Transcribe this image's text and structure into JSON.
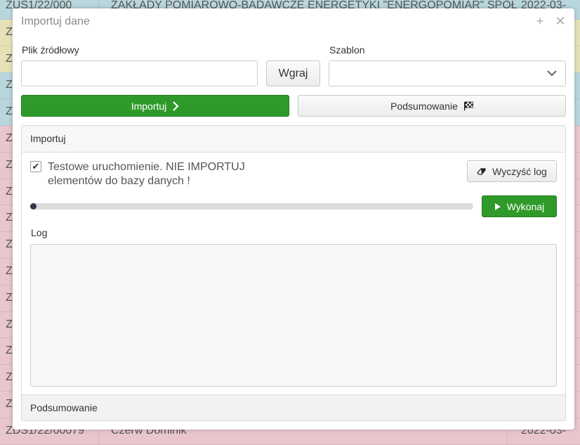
{
  "background": {
    "rows": [
      {
        "c1": "ZUS1/22/000",
        "c2": "ZAKŁADY POMIAROWO-BADAWCZE ENERGETYKI \"ENERGOPOMIAR\" SPÓŁ",
        "c3": "2022-03-",
        "color": "#b9d6dd"
      },
      {
        "c1": "ZU",
        "c2": "",
        "c3": "",
        "color": "#e6e2b8"
      },
      {
        "c1": "ZU",
        "c2": "",
        "c3": "",
        "color": "#e6e2b8"
      },
      {
        "c1": "ZU",
        "c2": "",
        "c3": "",
        "color": "#b9d6dd"
      },
      {
        "c1": "ZU",
        "c2": "",
        "c3": "",
        "color": "#b9d6dd"
      },
      {
        "c1": "Z",
        "c2": "",
        "c3": "",
        "color": "#e9c6cd"
      },
      {
        "c1": "Z",
        "c2": "",
        "c3": "",
        "color": "#e9c6cd"
      },
      {
        "c1": "Z",
        "c2": "",
        "c3": "",
        "color": "#e9c6cd"
      },
      {
        "c1": "Z",
        "c2": "",
        "c3": "",
        "color": "#e9c6cd"
      },
      {
        "c1": "Z",
        "c2": "",
        "c3": "",
        "color": "#e9c6cd"
      },
      {
        "c1": "Z",
        "c2": "",
        "c3": "",
        "color": "#e9c6cd"
      },
      {
        "c1": "Z",
        "c2": "",
        "c3": "",
        "color": "#e9c6cd"
      },
      {
        "c1": "Z",
        "c2": "",
        "c3": "",
        "color": "#e9c6cd"
      },
      {
        "c1": "Z",
        "c2": "",
        "c3": "",
        "color": "#e9c6cd"
      },
      {
        "c1": "Z",
        "c2": "",
        "c3": "",
        "color": "#e9c6cd"
      },
      {
        "c1": "Z",
        "c2": "",
        "c3": "",
        "color": "#e9c6cd"
      },
      {
        "c1": "ZDS1/22/00079",
        "c2": "Czerw Dominik",
        "c3": "2022-03-",
        "color": "#e9c6cd"
      }
    ]
  },
  "modal": {
    "title": "Importuj dane",
    "source_file_label": "Plik źródłowy",
    "source_file_value": "",
    "upload_label": "Wgraj",
    "template_label": "Szablon",
    "template_value": "",
    "import_tab_label": "Importuj",
    "summary_tab_label": "Podsumowanie",
    "panel_title": "Importuj",
    "test_run_line1": "Testowe uruchomienie. NIE IMPORTUJ",
    "test_run_line2": "elementów do bazy danych !",
    "test_run_checked": true,
    "clear_log_label": "Wyczyść log",
    "run_label": "Wykonaj",
    "progress_fraction": 0.0,
    "log_label": "Log",
    "log_value": "",
    "summary_label": "Podsumowanie",
    "colors": {
      "accent_green": "#2f9a2a"
    }
  }
}
